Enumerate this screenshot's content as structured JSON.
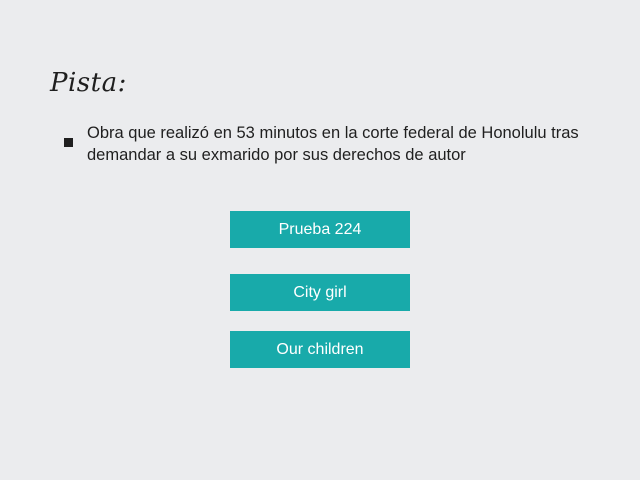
{
  "hint": {
    "title": "Pista:",
    "text": "Obra que realizó en 53 minutos en la corte federal de Honolulu tras demandar a su exmarido por sus derechos de autor"
  },
  "options": [
    {
      "label": "Prueba 224"
    },
    {
      "label": "City girl"
    },
    {
      "label": "Our children"
    }
  ],
  "colors": {
    "background": "#ebecee",
    "button": "#18aaaa",
    "button_text": "#ffffff",
    "text": "#1f1f1f"
  }
}
